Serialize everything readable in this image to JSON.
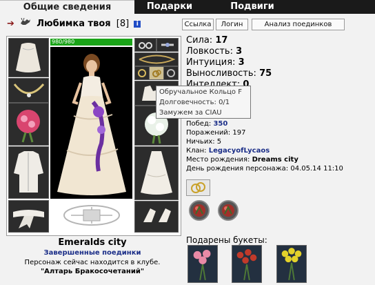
{
  "tabs": [
    {
      "label": "Общие сведения"
    },
    {
      "label": "Подарки"
    },
    {
      "label": "Подвиги"
    }
  ],
  "header": {
    "nick": "Любимка твоя",
    "level": "[8]",
    "info_icon": "i"
  },
  "buttons": {
    "link": "Ссылка",
    "login": "Логин",
    "battles": "Анализ поединков"
  },
  "hp": {
    "text": "980/980",
    "fraction": 1.0
  },
  "stats": {
    "strength": {
      "label": "Сила:",
      "value": "17"
    },
    "agility": {
      "label": "Ловкость:",
      "value": "3"
    },
    "intuition": {
      "label": "Интуиция:",
      "value": "3"
    },
    "endurance": {
      "label": "Выносливость:",
      "value": "75"
    },
    "intellect": {
      "label": "Интеллект:",
      "value": "0"
    }
  },
  "tooltip": {
    "line1": "Обручальное Кольцо F",
    "line2": "Долговечность: 0/1",
    "line3": "Замужем за CIAU"
  },
  "details": {
    "wins_label": "Побед:",
    "wins": "350",
    "losses_label": "Поражений:",
    "losses": "197",
    "draws_label": "Ничьих:",
    "draws": "5",
    "clan_label": "Клан:",
    "clan": "LegacyofLycaos",
    "birthplace_label": "Место рождения:",
    "birthplace": "Dreams city",
    "birthday_label": "День рождения персонажа:",
    "birthday": "04.05.14 11:10"
  },
  "location": {
    "city": "Emeralds city",
    "finished_link": "Завершенные поединки",
    "status": "Персонаж сейчас находится в клубе.",
    "room": "\"Алтарь Бракосочетаний\""
  },
  "bouquets": {
    "title": "Подарены букеты:"
  },
  "icons": [
    "arrow-right-icon",
    "goat-icon",
    "info-icon",
    "ring-icon",
    "red-orb-icon",
    "bouquet-icon"
  ],
  "colors": {
    "hp_bar": "#1aa318",
    "link": "#1b2e88",
    "tab_bar": "#1a1a1a"
  }
}
